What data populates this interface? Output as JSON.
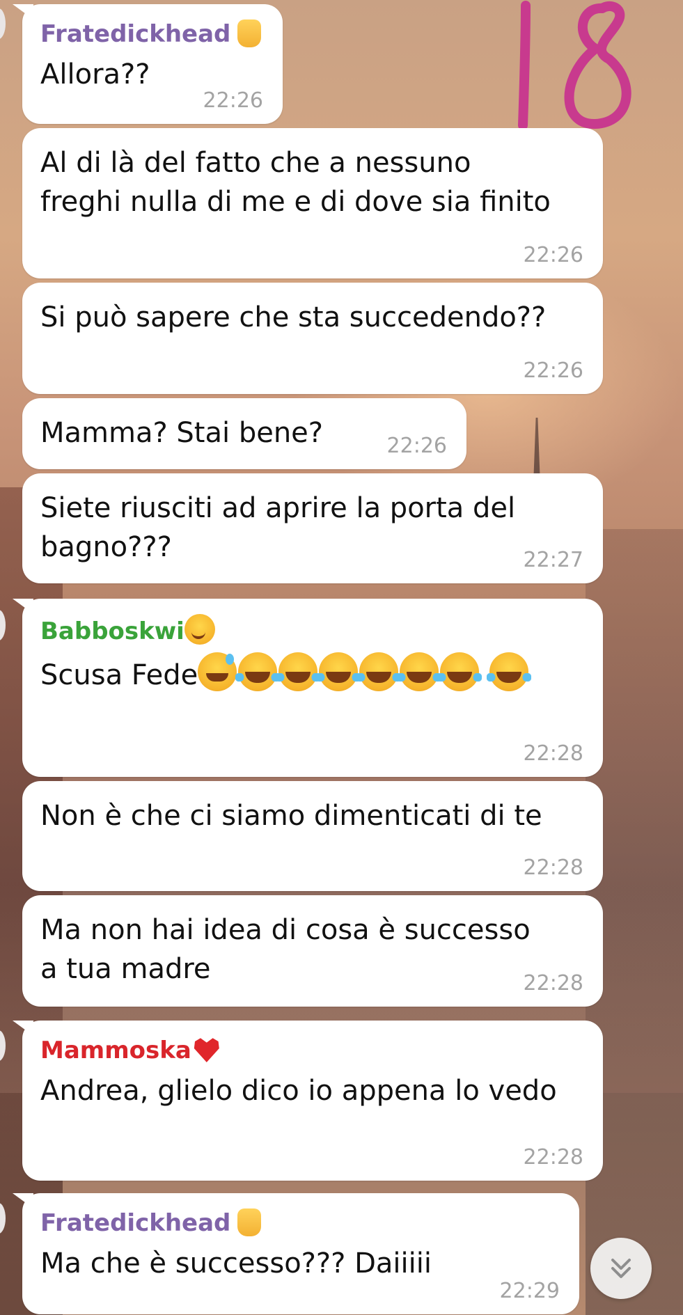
{
  "colors": {
    "sender_fratedickhead": "#7f63a8",
    "sender_babboskwi": "#3aa33a",
    "sender_mammoska": "#d9252b",
    "bubble_bg": "#ffffff",
    "time_text": "#a3a3a3",
    "annotation_marker": "#c83a8e"
  },
  "annotation": {
    "text": "18"
  },
  "messages": [
    {
      "sender": "Fratedickhead",
      "sender_emoji": "hand-icon",
      "text": "Allora??",
      "time": "22:26"
    },
    {
      "sender": "",
      "text": "Al di là del fatto che a nessuno\nfreghi nulla di me e di dove sia finito",
      "time": "22:26"
    },
    {
      "sender": "",
      "text": "Si può sapere che sta succedendo??",
      "time": "22:26"
    },
    {
      "sender": "",
      "text": "Mamma? Stai bene?",
      "time": "22:26"
    },
    {
      "sender": "",
      "text": "Siete riusciti ad aprire la porta del\nbagno???",
      "time": "22:27"
    },
    {
      "sender": "Babboskwi",
      "sender_emoji": "wink-emoji",
      "text": "Scusa Fede",
      "emojis": [
        "sweat-smile-emoji",
        "laugh-emoji",
        "laugh-emoji",
        "laugh-emoji",
        "laugh-emoji",
        "laugh-emoji",
        "laugh-emoji",
        "laugh-emoji"
      ],
      "time": "22:28"
    },
    {
      "sender": "",
      "text": "Non è che ci siamo dimenticati di te",
      "time": "22:28"
    },
    {
      "sender": "",
      "text": "Ma non hai idea di cosa è successo\na tua madre",
      "time": "22:28"
    },
    {
      "sender": "Mammoska",
      "sender_emoji": "heart-emoji",
      "text": "Andrea, glielo dico io appena lo vedo",
      "time": "22:28"
    },
    {
      "sender": "Fratedickhead",
      "sender_emoji": "hand-icon",
      "text": "Ma che è successo??? Daiiiii",
      "time": "22:29"
    }
  ],
  "scroll_button": {
    "icon": "double-chevron-down-icon"
  }
}
